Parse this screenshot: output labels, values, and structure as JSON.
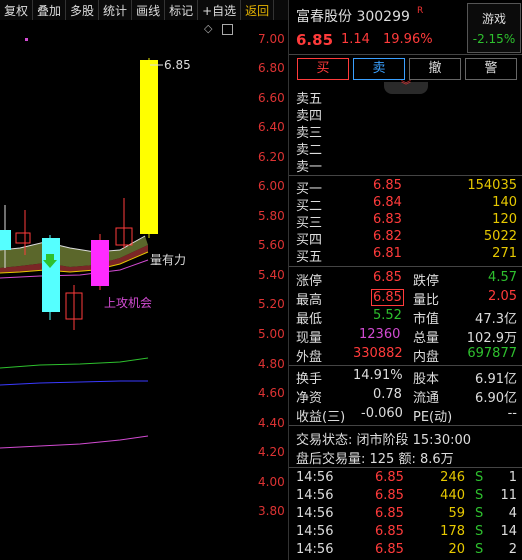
{
  "toolbar": {
    "items": [
      "复权",
      "叠加",
      "多股",
      "统计",
      "画线",
      "标记",
      "+自选",
      "返回"
    ]
  },
  "chart": {
    "y_ticks": [
      "7.00",
      "6.80",
      "6.60",
      "6.40",
      "6.20",
      "6.00",
      "5.80",
      "5.60",
      "5.40",
      "5.20",
      "5.00",
      "4.80",
      "4.60",
      "4.40",
      "4.20",
      "4.00",
      "3.80"
    ],
    "high_label": "6.85",
    "annot_volume": "量有力",
    "annot_attack": "上攻机会"
  },
  "quote": {
    "name": "富春股份",
    "code": "300299",
    "badge": "R",
    "price": "6.85",
    "change": "1.14",
    "change_pct": "19.96%",
    "game_label": "游戏",
    "game_pct": "-2.15%"
  },
  "buttons": {
    "buy": "买",
    "sell": "卖",
    "cancel": "撤",
    "alert": "警"
  },
  "asks": [
    {
      "label": "卖五"
    },
    {
      "label": "卖四"
    },
    {
      "label": "卖三"
    },
    {
      "label": "卖二"
    },
    {
      "label": "卖一"
    }
  ],
  "bids": [
    {
      "label": "买一",
      "price": "6.85",
      "vol": "154035"
    },
    {
      "label": "买二",
      "price": "6.84",
      "vol": "140"
    },
    {
      "label": "买三",
      "price": "6.83",
      "vol": "120"
    },
    {
      "label": "买四",
      "price": "6.82",
      "vol": "5022"
    },
    {
      "label": "买五",
      "price": "6.81",
      "vol": "271"
    }
  ],
  "stats": {
    "limit_up_label": "涨停",
    "limit_up": "6.85",
    "limit_down_label": "跌停",
    "limit_down": "4.57",
    "high_label": "最高",
    "high": "6.85",
    "vol_ratio_label": "量比",
    "vol_ratio": "2.05",
    "low_label": "最低",
    "low": "5.52",
    "mkt_cap_label": "市值",
    "mkt_cap": "47.3亿",
    "cur_vol_label": "现量",
    "cur_vol": "12360",
    "total_vol_label": "总量",
    "total_vol": "102.9万",
    "outer_label": "外盘",
    "outer": "330882",
    "inner_label": "内盘",
    "inner": "697877",
    "turnover_label": "换手",
    "turnover": "14.91%",
    "share_cap_label": "股本",
    "share_cap": "6.91亿",
    "nav_label": "净资",
    "nav": "0.78",
    "float_label": "流通",
    "float": "6.90亿",
    "eps_label": "收益(三)",
    "eps": "-0.060",
    "pe_label": "PE(动)",
    "pe": "--"
  },
  "status": {
    "state": "交易状态: 闭市阶段 15:30:00",
    "after_hours": "盘后交易量: 125  额: 8.6万"
  },
  "ticks": [
    {
      "time": "14:56",
      "price": "6.85",
      "vol": "246",
      "side": "S",
      "count": "1"
    },
    {
      "time": "14:56",
      "price": "6.85",
      "vol": "440",
      "side": "S",
      "count": "11"
    },
    {
      "time": "14:56",
      "price": "6.85",
      "vol": "59",
      "side": "S",
      "count": "4"
    },
    {
      "time": "14:56",
      "price": "6.85",
      "vol": "178",
      "side": "S",
      "count": "14"
    },
    {
      "time": "14:56",
      "price": "6.85",
      "vol": "20",
      "side": "S",
      "count": "2"
    }
  ]
}
